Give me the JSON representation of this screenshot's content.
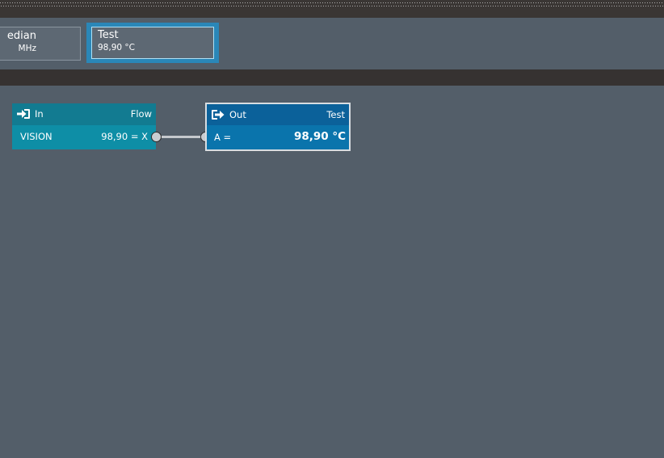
{
  "sensor_strip": {
    "tiles": [
      {
        "name": "edian",
        "value": "MHz",
        "selected": false
      },
      {
        "name": "Test",
        "value": "98,90 °C",
        "selected": true
      }
    ]
  },
  "flow": {
    "input_node": {
      "title": "In",
      "right_label": "Flow",
      "icon": "sign-in-icon",
      "row_label": "VISION",
      "row_value": "98,90 = X"
    },
    "output_node": {
      "title": "Out",
      "right_label": "Test",
      "icon": "sign-out-icon",
      "row_label": "A =",
      "row_value": "98,90 °C"
    }
  },
  "colors": {
    "background": "#535e69",
    "input_node": "#0e8ea6",
    "output_node": "#0a74ac",
    "selected_tile_border": "#2a87b8"
  }
}
